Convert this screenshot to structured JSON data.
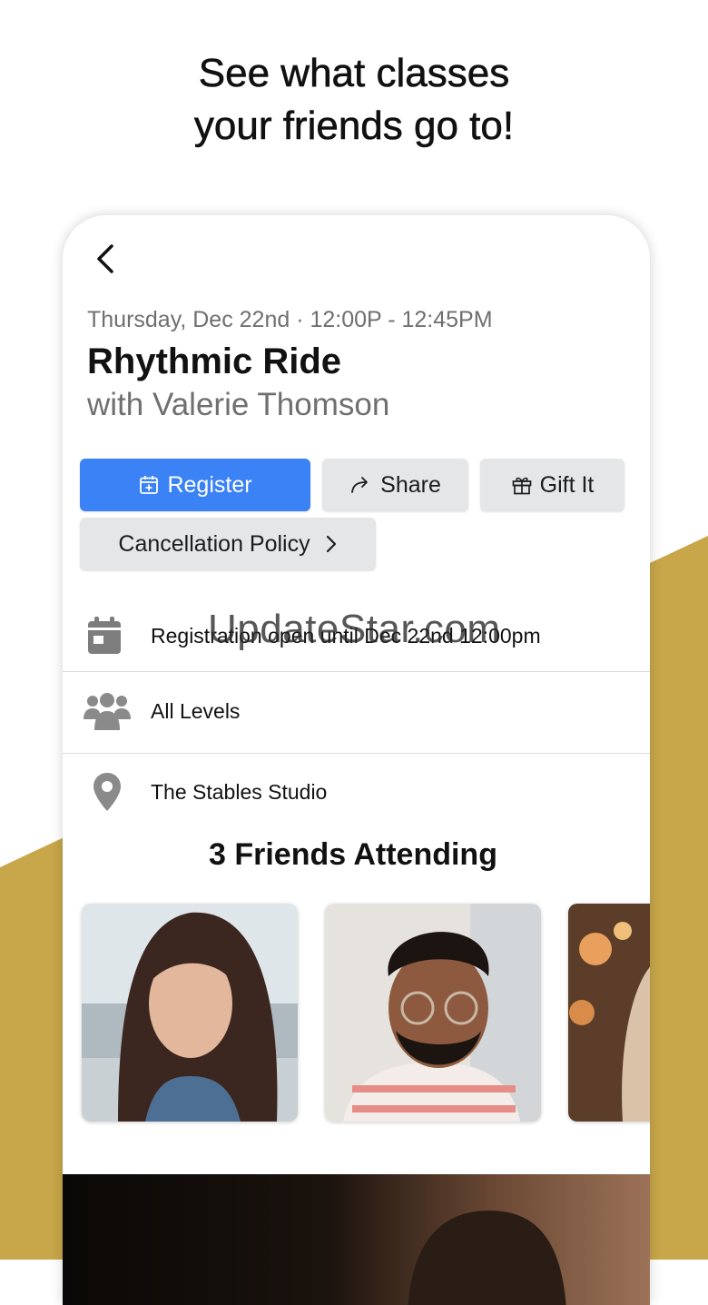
{
  "headline": {
    "line1": "See what classes",
    "line2": "your friends go to!"
  },
  "class": {
    "datetime": "Thursday, Dec 22nd · 12:00P - 12:45PM",
    "title": "Rhythmic Ride",
    "instructor": "with Valerie Thomson"
  },
  "actions": {
    "register": "Register",
    "share": "Share",
    "gift": "Gift It",
    "cancellation": "Cancellation Policy"
  },
  "details": {
    "registration": "Registration open until Dec 22nd 12:00pm",
    "level": "All Levels",
    "location": "The Stables Studio"
  },
  "watermark": "UpdateStar.com",
  "friends": {
    "title": "3 Friends Attending"
  },
  "colors": {
    "accent": "#3b82f6",
    "gold": "#c8a74a",
    "button_bg": "#e5e6e8"
  },
  "icons": [
    "chevron-left-icon",
    "calendar-plus-icon",
    "share-arrow-icon",
    "gift-icon",
    "chevron-right-icon",
    "calendar-icon",
    "group-icon",
    "map-pin-icon"
  ]
}
